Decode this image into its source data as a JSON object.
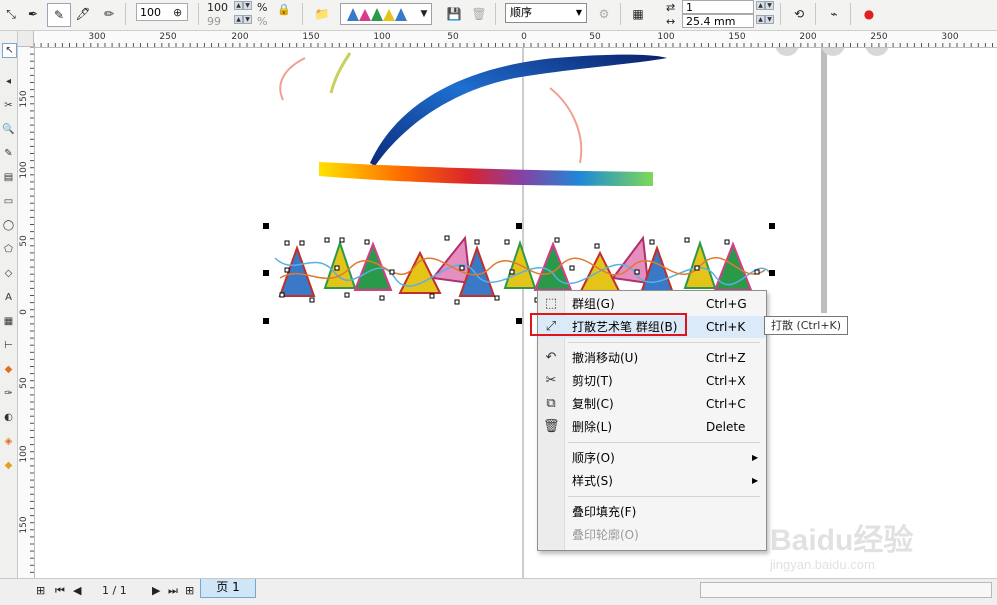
{
  "toolbar": {
    "size_value": "100",
    "scale_x": "100",
    "scale_y": "99",
    "percent_1": "%",
    "percent_2": "%",
    "order_select": "顺序",
    "copies_value": "1",
    "distance_value": "25.4 mm"
  },
  "ruler": {
    "h_labels": [
      "300",
      "250",
      "200",
      "150",
      "100",
      "50",
      "0",
      "50",
      "100",
      "150",
      "200",
      "250",
      "300"
    ],
    "v_labels": [
      "150",
      "100",
      "50",
      "0",
      "50",
      "100",
      "150"
    ]
  },
  "status": {
    "page_counter": "1 / 1",
    "page_tab": "页 1"
  },
  "context_menu": {
    "items": [
      {
        "label": "群组(G)",
        "shortcut": "Ctrl+G",
        "icon": "group-icon",
        "enabled": true
      },
      {
        "label": "打散艺术笔 群组(B)",
        "shortcut": "Ctrl+K",
        "icon": "break-apart-icon",
        "enabled": true,
        "highlighted": true
      },
      {
        "label": "撤消移动(U)",
        "shortcut": "Ctrl+Z",
        "icon": "undo-icon",
        "enabled": true
      },
      {
        "label": "剪切(T)",
        "shortcut": "Ctrl+X",
        "icon": "scissors-icon",
        "enabled": true
      },
      {
        "label": "复制(C)",
        "shortcut": "Ctrl+C",
        "icon": "copy-icon",
        "enabled": true
      },
      {
        "label": "删除(L)",
        "shortcut": "Delete",
        "icon": "trash-icon",
        "enabled": true
      },
      {
        "label": "顺序(O)",
        "shortcut": "",
        "icon": "",
        "enabled": true,
        "submenu": true
      },
      {
        "label": "样式(S)",
        "shortcut": "",
        "icon": "",
        "enabled": true,
        "submenu": true
      },
      {
        "label": "叠印填充(F)",
        "shortcut": "",
        "icon": "",
        "enabled": true
      },
      {
        "label": "叠印轮廓(O)",
        "shortcut": "",
        "icon": "",
        "enabled": false
      }
    ]
  },
  "tooltip": "打散 (Ctrl+K)",
  "watermark": {
    "brand": "Baidu经验",
    "url": "jingyan.baidu.com"
  }
}
